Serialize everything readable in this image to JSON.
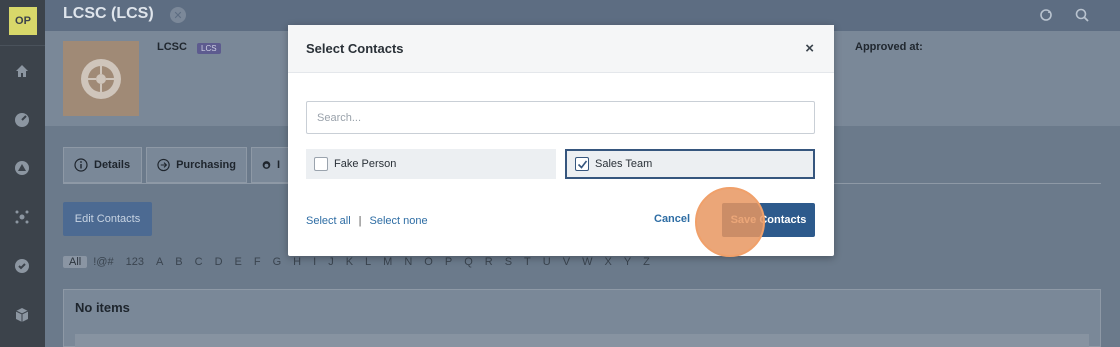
{
  "sidebar": {
    "logo": "OP"
  },
  "topbar": {
    "title": "LCSC (LCS)"
  },
  "record": {
    "name": "LCSC",
    "badge": "LCS",
    "approved_label": "Approved at:"
  },
  "tabs": [
    "Details",
    "Purchasing",
    "I"
  ],
  "actions": {
    "edit_contacts": "Edit Contacts"
  },
  "alphabet": [
    "All",
    "!@#",
    "123",
    "A",
    "B",
    "C",
    "D",
    "E",
    "F",
    "G",
    "H",
    "I",
    "J",
    "K",
    "L",
    "M",
    "N",
    "O",
    "P",
    "Q",
    "R",
    "S",
    "T",
    "U",
    "V",
    "W",
    "X",
    "Y",
    "Z"
  ],
  "list": {
    "empty_label": "No items"
  },
  "modal": {
    "title": "Select Contacts",
    "close": "×",
    "search_placeholder": "Search...",
    "contacts": [
      {
        "label": "Fake Person",
        "checked": false
      },
      {
        "label": "Sales Team",
        "checked": true
      }
    ],
    "select_all": "Select all",
    "separator": "|",
    "select_none": "Select none",
    "cancel": "Cancel",
    "save": "Save Contacts"
  }
}
